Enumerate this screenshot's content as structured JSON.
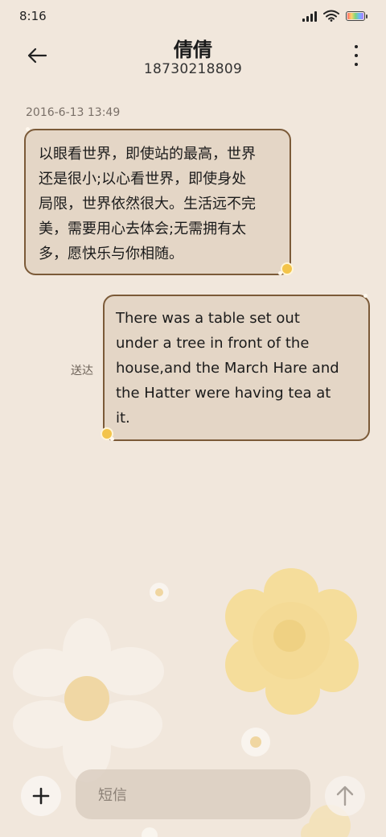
{
  "status_bar": {
    "time": "8:16"
  },
  "header": {
    "contact_name": "倩倩",
    "contact_number": "18730218809"
  },
  "conversation": {
    "timestamp": "2016-6-13 13:49",
    "messages": [
      {
        "direction": "incoming",
        "lines": [
          "以眼看世界，即使站的最高，世界",
          "还是很小;以心看世界，即使身处",
          "局限，世界依然很大。生活远不完",
          "美，需要用心去体会;无需拥有太",
          "多，愿快乐与你相随。"
        ]
      },
      {
        "direction": "outgoing",
        "lines": [
          "There was a table set out",
          "under a tree in front of the",
          "house,and the March Hare and",
          "the Hatter were having tea at",
          "it."
        ],
        "status": "送达"
      }
    ]
  },
  "composer": {
    "placeholder": "短信"
  },
  "icons": {
    "back": "arrow-left-icon",
    "more": "more-vertical-icon",
    "add": "plus-icon",
    "send": "arrow-up-icon"
  },
  "colors": {
    "background": "#f1e7dc",
    "bubble_fill": "#e4d6c6",
    "bubble_border": "#7b5a38",
    "accent_flower": "#f3c44a"
  }
}
